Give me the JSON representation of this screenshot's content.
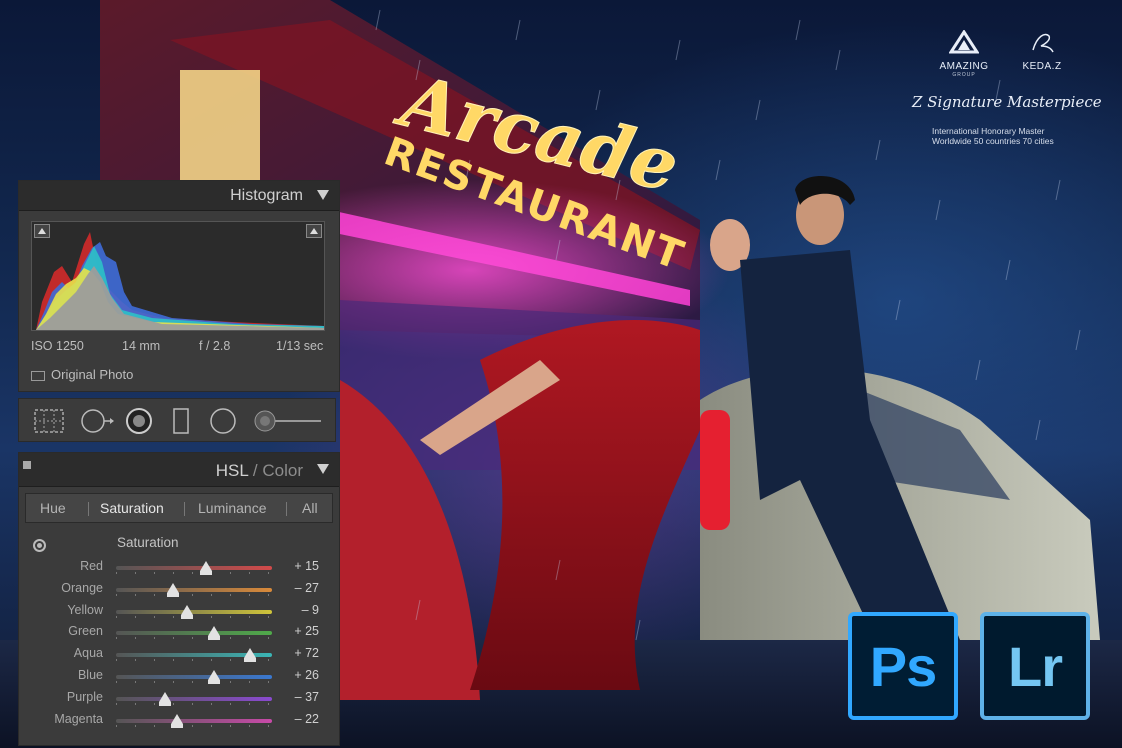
{
  "brand": {
    "logo1_name": "AMAZING",
    "logo1_sub": "GROUP",
    "logo2_name": "KEDA.Z",
    "signature": "Z Signature Masterpiece",
    "line1": "International Honorary Master",
    "line2": "Worldwide 50 countries 70 cities"
  },
  "neon_sign": {
    "script_word": "Arcade",
    "block_word": "RESTAURANT"
  },
  "histogram_panel": {
    "title": "Histogram",
    "exif": {
      "iso": "ISO 1250",
      "focal": "14 mm",
      "aperture": "f / 2.8",
      "shutter": "1/13 sec"
    },
    "original_photo_label": "Original Photo"
  },
  "tool_strip": {
    "tools": [
      "grid-icon",
      "crop-overlay-icon",
      "spot-removal-icon",
      "graduated-filter-icon",
      "radial-filter-icon",
      "adjustment-brush-icon"
    ]
  },
  "hsl_panel": {
    "title_main": "HSL",
    "title_sep": " / ",
    "title_dim": "Color",
    "tabs": [
      "Hue",
      "Saturation",
      "Luminance",
      "All"
    ],
    "active_tab": "Saturation",
    "section_heading": "Saturation",
    "rows": [
      {
        "label": "Red",
        "value": 15,
        "display": "+ 15",
        "color": "#d24a4a"
      },
      {
        "label": "Orange",
        "value": -27,
        "display": "– 27",
        "color": "#d98a3a"
      },
      {
        "label": "Yellow",
        "value": -9,
        "display": "– 9",
        "color": "#cfc43a"
      },
      {
        "label": "Green",
        "value": 25,
        "display": "+ 25",
        "color": "#4faa4a"
      },
      {
        "label": "Aqua",
        "value": 72,
        "display": "+ 72",
        "color": "#3ab6b6"
      },
      {
        "label": "Blue",
        "value": 26,
        "display": "+ 26",
        "color": "#3a78d0"
      },
      {
        "label": "Purple",
        "value": -37,
        "display": "– 37",
        "color": "#8a4ad0"
      },
      {
        "label": "Magenta",
        "value": -22,
        "display": "– 22",
        "color": "#c84aa8"
      }
    ]
  },
  "app_badges": {
    "photoshop": "Ps",
    "lightroom": "Lr"
  },
  "colors": {
    "panel_bg": "#3b3b3b",
    "panel_header": "#2c2c2c",
    "ps_accent": "#31a8ff",
    "lr_accent": "#74c6f2",
    "neon_yellow": "#ffd866",
    "neon_pink": "#ff3fd6"
  }
}
